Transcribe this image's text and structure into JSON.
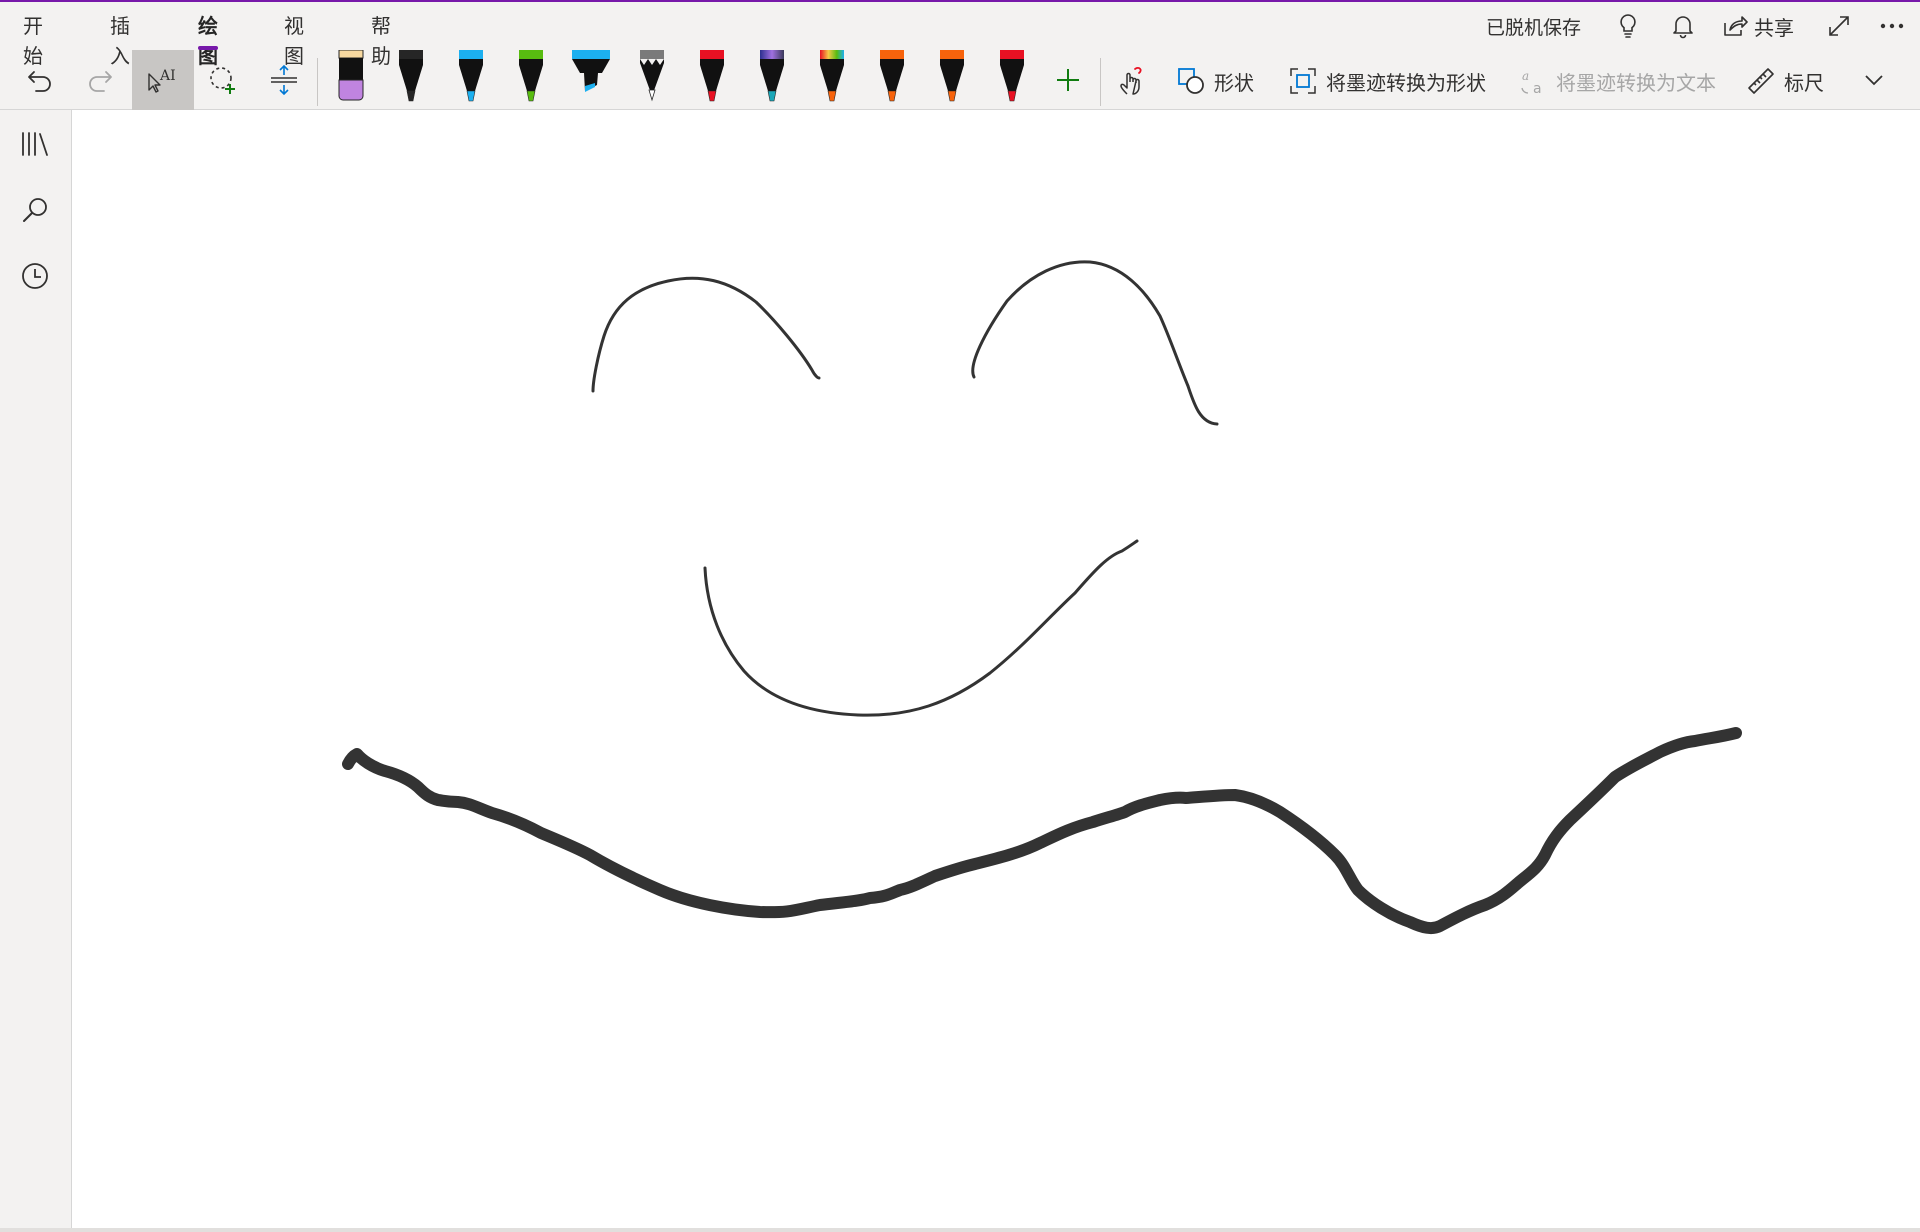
{
  "menu": {
    "tabs": [
      {
        "label": "开始"
      },
      {
        "label": "插入"
      },
      {
        "label": "绘图",
        "active": true
      },
      {
        "label": "视图"
      },
      {
        "label": "帮助"
      }
    ]
  },
  "status": {
    "save_status": "已脱机保存"
  },
  "top_actions": {
    "share_label": "共享",
    "icons": [
      "lightbulb-icon",
      "bell-icon",
      "share-icon",
      "expand-icon",
      "more-icon"
    ]
  },
  "toolbar": {
    "tools": [
      "undo",
      "redo",
      "type-select",
      "lasso-select",
      "add-space"
    ],
    "selected_tool": "type-select",
    "pens": [
      {
        "kind": "eraser",
        "color": "#c084e0"
      },
      {
        "kind": "pen",
        "color": "#262626"
      },
      {
        "kind": "pen",
        "color": "#1cb0f0"
      },
      {
        "kind": "pen",
        "color": "#58bc10"
      },
      {
        "kind": "highlighter",
        "color": "#1cb0f0"
      },
      {
        "kind": "pencil",
        "color": "#7a7a7a"
      },
      {
        "kind": "pen",
        "color": "#e81123"
      },
      {
        "kind": "galaxy-pen",
        "color": "#4a5bd1"
      },
      {
        "kind": "rainbow-pen",
        "color": "#e8a33a"
      },
      {
        "kind": "pen",
        "color": "#f7630c"
      },
      {
        "kind": "pen",
        "color": "#f7630c"
      },
      {
        "kind": "pen",
        "color": "#e81123"
      }
    ],
    "add_pen_icon": "plus-icon",
    "touch_draw_icon": "touch-draw-icon",
    "shapes_label": "形状",
    "ink_to_shape_label": "将墨迹转换为形状",
    "ink_to_text_label": "将墨迹转换为文本",
    "ruler_label": "标尺",
    "overflow_icon": "chevron-down-icon"
  },
  "sidebar": {
    "icons": [
      "notebooks-icon",
      "search-icon",
      "recent-icon"
    ]
  },
  "colors": {
    "accent": "#7719aa",
    "ink": "#333333",
    "ribbon_bg": "#f3f2f1"
  }
}
